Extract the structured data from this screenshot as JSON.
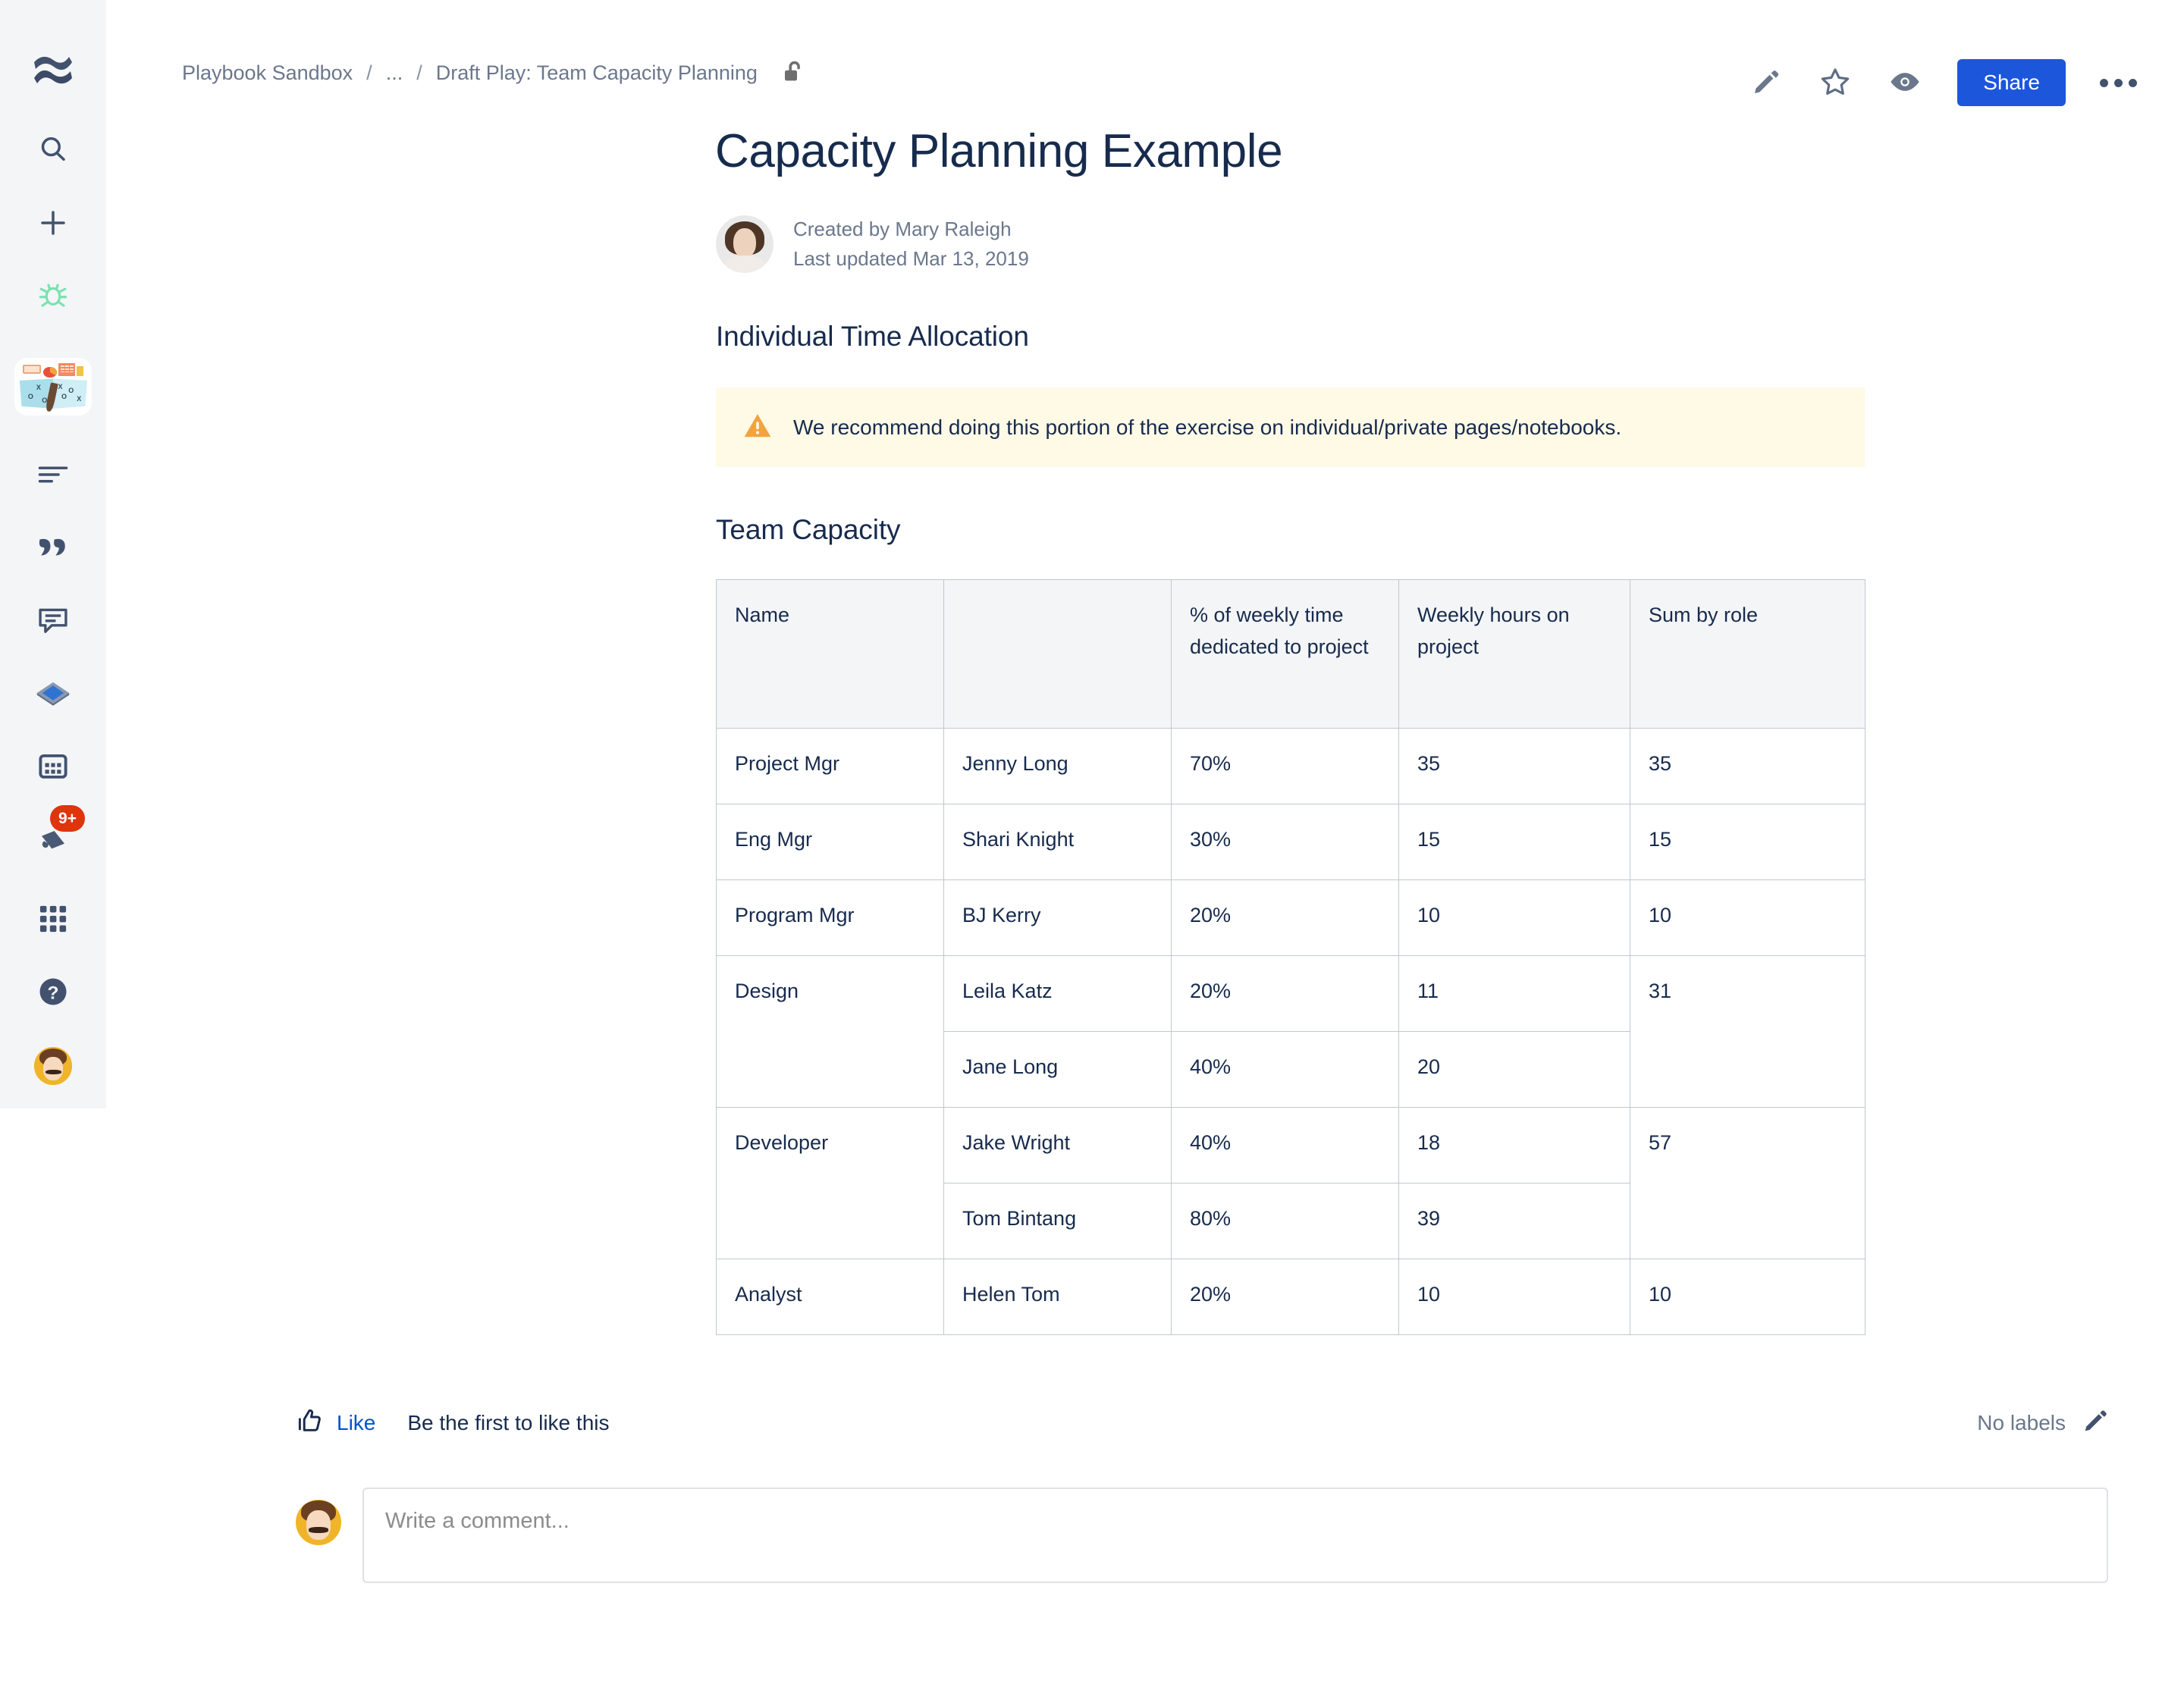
{
  "sidebar": {
    "items": [
      {
        "name": "confluence-logo-icon",
        "label": "Confluence"
      },
      {
        "name": "search-icon",
        "label": "Search"
      },
      {
        "name": "create-icon",
        "label": "Create"
      },
      {
        "name": "bug-icon",
        "label": "Bug"
      },
      {
        "name": "playbook-thumbnail-icon",
        "label": "Playbook Sandbox"
      },
      {
        "name": "pages-icon",
        "label": "Pages"
      },
      {
        "name": "blog-quote-icon",
        "label": "Blog"
      },
      {
        "name": "comment-icon",
        "label": "Comments"
      },
      {
        "name": "inbox-icon",
        "label": "Inbox"
      },
      {
        "name": "calendar-icon",
        "label": "Calendars"
      },
      {
        "name": "notifications-icon",
        "label": "Notifications"
      },
      {
        "name": "app-switcher-icon",
        "label": "Apps"
      },
      {
        "name": "help-icon",
        "label": "Help"
      },
      {
        "name": "profile-avatar",
        "label": "Profile"
      }
    ],
    "notification_badge": "9+"
  },
  "breadcrumb": {
    "space": "Playbook Sandbox",
    "sep": "/",
    "ellipsis": "...",
    "page": "Draft Play: Team Capacity Planning",
    "restriction_icon": "unlocked-padlock-icon"
  },
  "toolbar": {
    "edit_label": "Edit",
    "watch_label": "Watch",
    "star_label": "Star",
    "share_label": "Share",
    "more_label": "More actions",
    "share_color": "#1C56DB"
  },
  "page": {
    "title": "Capacity Planning Example",
    "created_by": "Created by Mary Raleigh",
    "last_updated": "Last updated Mar 13, 2019"
  },
  "sections": {
    "individual": {
      "heading": "Individual Time Allocation",
      "warning": "We recommend doing this portion of the exercise on individual/private pages/notebooks.",
      "warning_bg": "#FFFAE6",
      "warning_icon": "warning-triangle-icon"
    },
    "team": {
      "heading": "Team Capacity"
    }
  },
  "table": {
    "headers": [
      "Name",
      "",
      "% of weekly time dedicated to project",
      "Weekly hours on project",
      "Sum by role"
    ],
    "rows": [
      {
        "role": "Project Mgr",
        "role_rowspan": 1,
        "name": "Jenny Long",
        "pct": "70%",
        "hours": "35",
        "sum": "35",
        "sum_rowspan": 1
      },
      {
        "role": "Eng Mgr",
        "role_rowspan": 1,
        "name": "Shari Knight",
        "pct": "30%",
        "hours": "15",
        "sum": "15",
        "sum_rowspan": 1
      },
      {
        "role": "Program Mgr",
        "role_rowspan": 1,
        "name": "BJ Kerry",
        "pct": "20%",
        "hours": "10",
        "sum": "10",
        "sum_rowspan": 1
      },
      {
        "role": "Design",
        "role_rowspan": 2,
        "name": "Leila Katz",
        "pct": "20%",
        "hours": "11",
        "sum": "31",
        "sum_rowspan": 2
      },
      {
        "role": null,
        "role_rowspan": 0,
        "name": "Jane Long",
        "pct": "40%",
        "hours": "20",
        "sum": null,
        "sum_rowspan": 0
      },
      {
        "role": "Developer",
        "role_rowspan": 2,
        "name": "Jake Wright",
        "pct": "40%",
        "hours": "18",
        "sum": "57",
        "sum_rowspan": 2
      },
      {
        "role": null,
        "role_rowspan": 0,
        "name": "Tom Bintang",
        "pct": "80%",
        "hours": "39",
        "sum": null,
        "sum_rowspan": 0
      },
      {
        "role": "Analyst",
        "role_rowspan": 1,
        "name": "Helen Tom",
        "pct": "20%",
        "hours": "10",
        "sum": "10",
        "sum_rowspan": 1
      }
    ]
  },
  "footer": {
    "like_label": "Like",
    "like_icon": "thumbs-up-icon",
    "like_note": "Be the first to like this",
    "labels_text": "No labels",
    "labels_edit_icon": "pencil-icon",
    "like_color": "#0052CC"
  },
  "comment": {
    "placeholder": "Write a comment...",
    "value": ""
  }
}
